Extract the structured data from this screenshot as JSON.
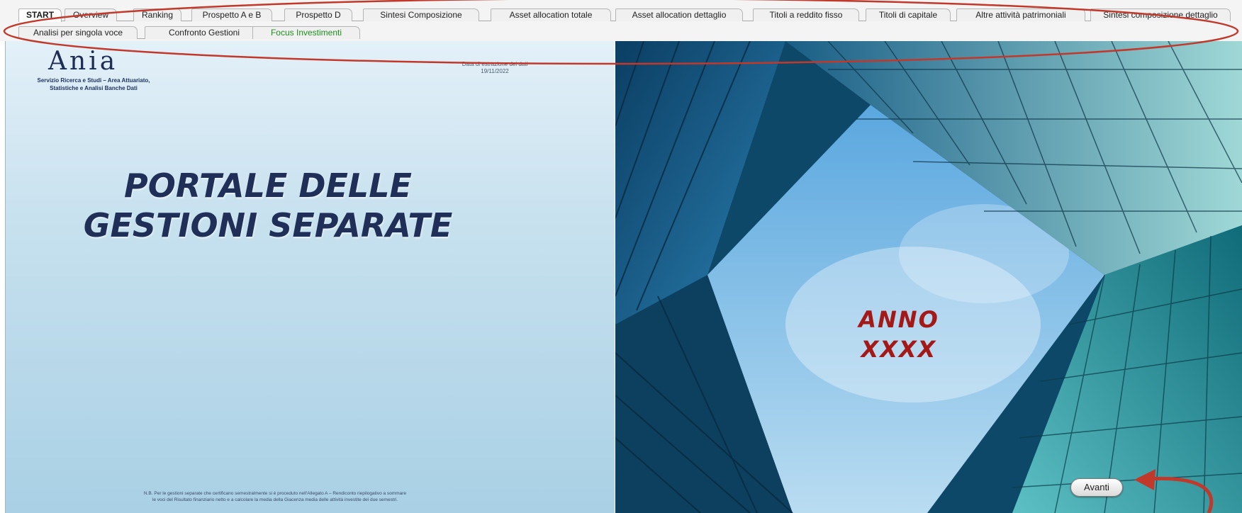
{
  "tabs": {
    "row1": [
      {
        "label": "START",
        "active": true
      },
      {
        "label": "Overview"
      },
      {
        "label": "Ranking"
      },
      {
        "label": "Prospetto A e B"
      },
      {
        "label": "Prospetto D"
      },
      {
        "label": "Sintesi Composizione"
      },
      {
        "label": "Asset allocation totale"
      },
      {
        "label": "Asset allocation dettaglio"
      },
      {
        "label": "Titoli a reddito fisso"
      },
      {
        "label": "Titoli di capitale"
      },
      {
        "label": "Altre attività patrimoniali"
      },
      {
        "label": "Sintesi composizione dettaglio"
      }
    ],
    "row2": [
      {
        "label": "Analisi per singola voce"
      },
      {
        "label": "Confronto Gestioni"
      },
      {
        "label": "Focus Investimenti",
        "highlight_color": "#1f8f1f"
      }
    ]
  },
  "left": {
    "logo": "Ania",
    "service_line1": "Servizio Ricerca e Studi – Area Attuariato,",
    "service_line2": "Statistiche e Analisi Banche Dati",
    "date_caption": "Data di estrazione dei dati",
    "date_value": "19/11/2022",
    "title_line1": "PORTALE DELLE",
    "title_line2": "GESTIONI SEPARATE",
    "footnote_line1": "N.B. Per le gestioni separate che certificano semestralmente si è proceduto nell'Allegato A – Rendiconto riepilogativo a sommare",
    "footnote_line2": "le voci del Risultato finanziario netto e a calcolare la media della Giacenza media delle attività investite dei due semestri."
  },
  "right": {
    "anno_line1": "ANNO",
    "anno_line2": "XXXX",
    "avanti_label": "Avanti"
  },
  "colors": {
    "title": "#1f2f57",
    "anno": "#a41818",
    "annotation": "#c0392b",
    "active_tab_green": "#1f8f1f"
  },
  "icons": {
    "annotation_ellipse": "red-ellipse-outline",
    "annotation_arrow": "red-curved-arrow"
  }
}
